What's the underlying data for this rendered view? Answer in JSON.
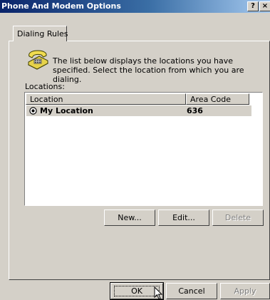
{
  "window": {
    "title": "Phone And Modem Options",
    "help_label": "?",
    "close_label": "×"
  },
  "tabs": [
    {
      "label": "Dialing Rules",
      "active": true
    }
  ],
  "dialing_rules": {
    "icon": "phone-icon",
    "description": "The list below displays the locations you have specified. Select the location from which you are dialing.",
    "locations_label": "Locations:",
    "columns": [
      "Location",
      "Area Code"
    ],
    "rows": [
      {
        "location": "My Location",
        "area_code": "636",
        "selected": true
      }
    ],
    "buttons": {
      "new": "New...",
      "edit": "Edit...",
      "delete": "Delete"
    }
  },
  "footer_buttons": {
    "ok": "OK",
    "cancel": "Cancel",
    "apply": "Apply"
  },
  "colors": {
    "dialog_bg": "#d4d0c8",
    "title_gradient_start": "#0a246a",
    "title_gradient_end": "#a6caf0",
    "selected_row": "#d4d0c8"
  }
}
